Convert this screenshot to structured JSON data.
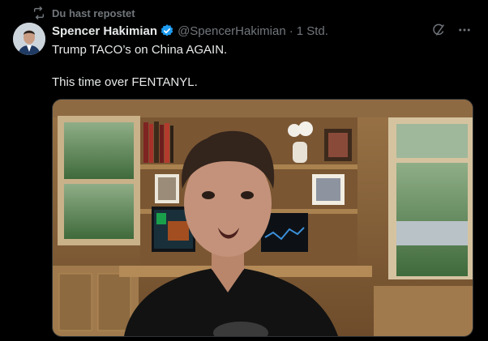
{
  "repost": {
    "label": "Du hast repostet",
    "icon": "repost-icon"
  },
  "tweet": {
    "author_name": "Spencer Hakimian",
    "handle": "@SpencerHakimian",
    "separator": "·",
    "time": "1 Std.",
    "verified_icon": "verified-badge-icon",
    "text_lines": [
      "Trump TACO’s on China AGAIN.",
      "This time over FENTANYL."
    ],
    "actions": [
      "grok-icon",
      "more-icon"
    ]
  },
  "media": {
    "type": "video-thumbnail"
  },
  "colors": {
    "background": "#000000",
    "text": "#e7e9ea",
    "muted": "#71767b",
    "verified": "#1d9bf0"
  }
}
